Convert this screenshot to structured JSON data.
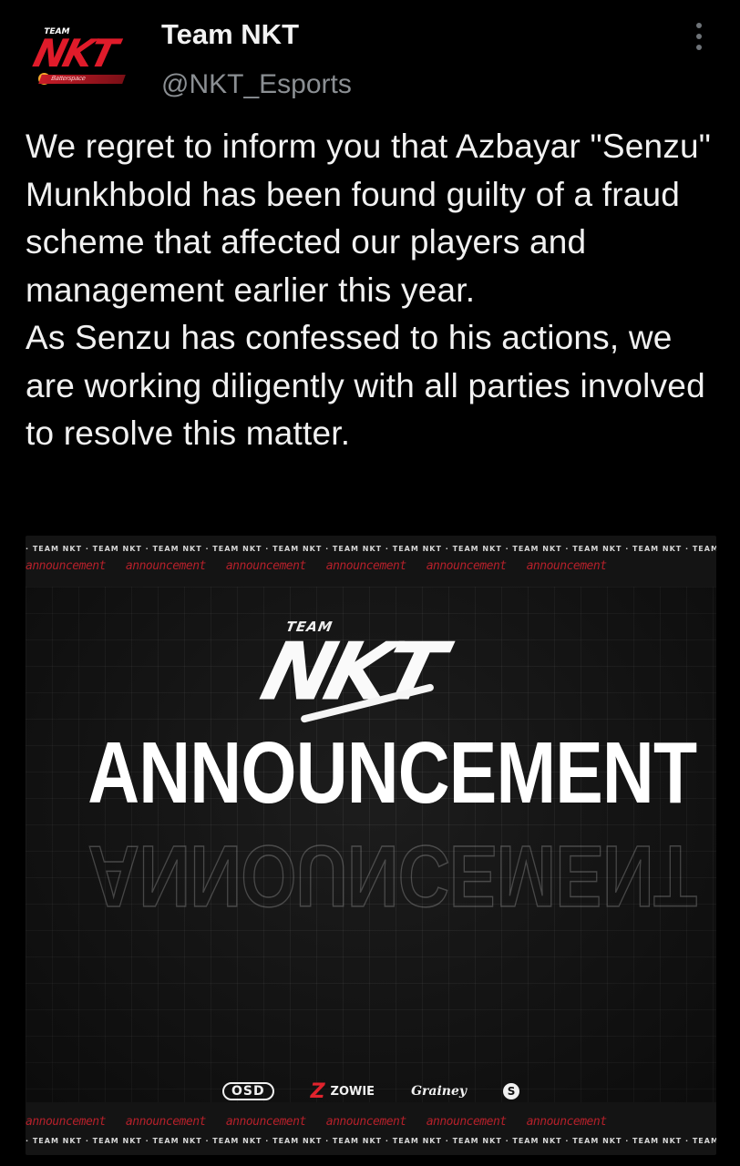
{
  "author": {
    "display_name": "Team NKT",
    "handle": "@NKT_Esports",
    "avatar": {
      "team_label": "TEAM",
      "logo_text": "NKT",
      "sponsor_text": "Batterspace"
    }
  },
  "tweet": {
    "text": "We regret to inform you that Azbayar \"Senzu\" Munkhbold has been found guilty of a fraud scheme that affected our players and management earlier this year.\nAs Senzu has confessed to his actions, we are working diligently with all parties involved to resolve this matter."
  },
  "media": {
    "strip_team_text": "· TEAM NKT · TEAM NKT · TEAM NKT · TEAM NKT · TEAM NKT · TEAM NKT · TEAM NKT · TEAM NKT · TEAM NKT · TEAM NKT · TEAM NKT · TEAM NKT · T",
    "strip_announcement_words": [
      "announcement",
      "announcement",
      "announcement",
      "announcement",
      "announcement",
      "announcement"
    ],
    "team_word": "TEAM",
    "logo_text": "NKT",
    "headline": "ANNOUNCEMENT",
    "sponsors": {
      "osd": "OSD",
      "zowie_mark": "Z",
      "zowie": "ZOWIE",
      "gainey": "Grainey",
      "s_mark": "S"
    }
  },
  "colors": {
    "background": "#000000",
    "text": "#f1f1f1",
    "handle": "#8b8f93",
    "brand_red": "#e01b2a"
  }
}
